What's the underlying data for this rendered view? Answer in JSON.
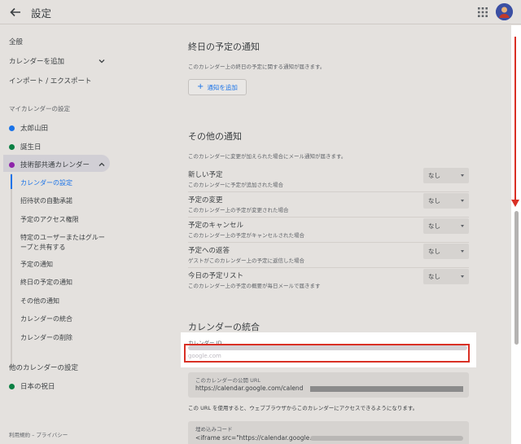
{
  "header": {
    "title": "設定"
  },
  "sidebar": {
    "general": "全般",
    "add_calendar": "カレンダーを追加",
    "import_export": "インポート / エクスポート",
    "my_calendars_heading": "マイカレンダーの設定",
    "calendars": [
      {
        "label": "太郎山田",
        "color": "#1a73e8"
      },
      {
        "label": "誕生日",
        "color": "#0b8043"
      },
      {
        "label": "技術部共通カレンダー",
        "color": "#8e24aa"
      }
    ],
    "sub_items": [
      "カレンダーの設定",
      "招待状の自動承諾",
      "予定のアクセス権限",
      "特定のユーザーまたはグルー",
      "ープと共有する",
      "予定の通知",
      "終日の予定の通知",
      "その他の通知",
      "カレンダーの統合",
      "カレンダーの削除"
    ],
    "other_calendars_heading": "他のカレンダーの設定",
    "other_calendars": [
      {
        "label": "日本の祝日",
        "color": "#0b8043"
      }
    ],
    "footer": "利用規約 – プライバシー"
  },
  "allday": {
    "title": "終日の予定の通知",
    "desc": "このカレンダー上の終日の予定に関する通知が届きます。",
    "add_label": "通知を追加"
  },
  "other": {
    "title": "その他の通知",
    "desc": "このカレンダーに変更が加えられた場合にメール通知が届きます。",
    "rows": [
      {
        "label": "新しい予定",
        "sub": "このカレンダーに予定が追加された場合",
        "value": "なし"
      },
      {
        "label": "予定の変更",
        "sub": "このカレンダー上の予定が変更された場合",
        "value": "なし"
      },
      {
        "label": "予定のキャンセル",
        "sub": "このカレンダー上の予定がキャンセルされた場合",
        "value": "なし"
      },
      {
        "label": "予定への返答",
        "sub": "ゲストがこのカレンダー上の予定に返信した場合",
        "value": "なし"
      },
      {
        "label": "今日の予定リスト",
        "sub": "このカレンダー上の予定の概要が毎日メールで届きます",
        "value": "なし"
      }
    ]
  },
  "integration": {
    "title": "カレンダーの統合",
    "id_label": "カレンダー ID",
    "id_suffix": "google.com",
    "public_url_label": "このカレンダーの公開 URL",
    "public_url": "https://calendar.google.com/calend",
    "url_note": "この URL を使用すると、ウェブブラウザからこのカレンダーにアクセスできるようになります。",
    "embed_label": "埋め込みコード",
    "embed_code": "<iframe src=\"https://calendar.google.c"
  },
  "colors": {
    "accent": "#1a73e8",
    "annotation_red": "#d93025"
  }
}
